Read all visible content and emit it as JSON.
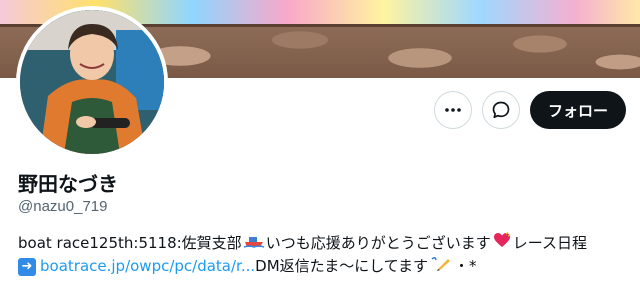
{
  "profile": {
    "display_name": "野田なづき",
    "handle": "@nazu0_719"
  },
  "actions": {
    "more_icon": "ellipsis-icon",
    "message_icon": "chat-bubble-icon",
    "follow_label": "フォロー"
  },
  "bio": {
    "line1_part1": "boat race125th:5118:佐賀支部",
    "line1_part2": " いつも応援ありがとうございます",
    "line1_part3": " レース日程",
    "line2_link": "boatrace.jp/owpc/pc/data/r...",
    "line2_text": " DM返信たま〜にしてます",
    "line2_tail": "・*"
  },
  "colors": {
    "follow_bg": "#0f1419",
    "link": "#1d9bf0",
    "handle": "#536471"
  }
}
